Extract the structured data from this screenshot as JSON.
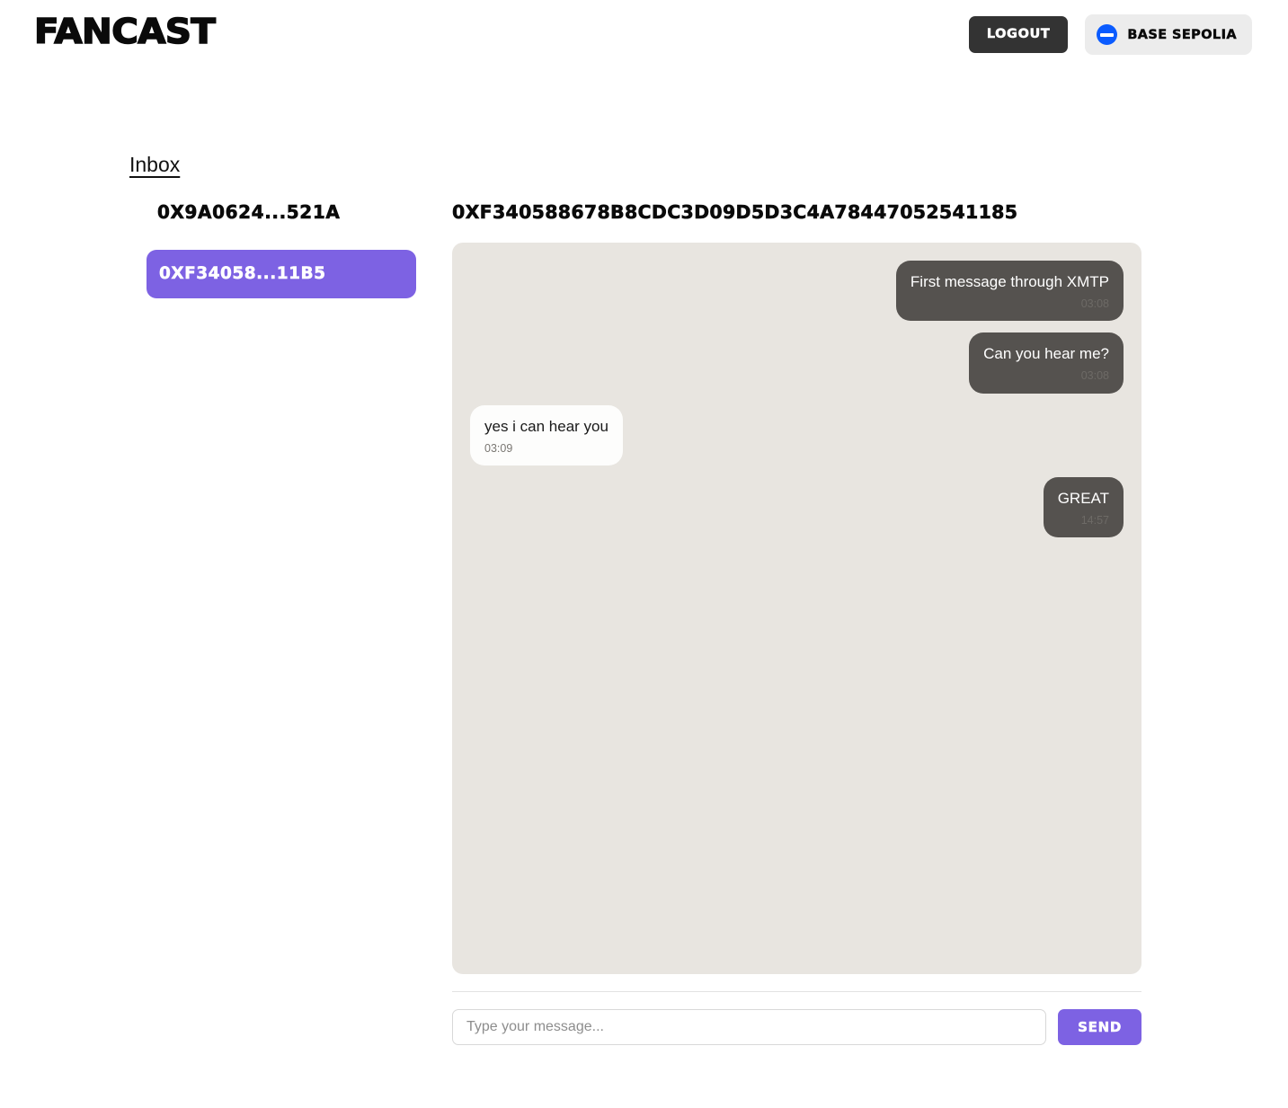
{
  "header": {
    "brand": "FANCAST",
    "logout_label": "LOGOUT",
    "network_label": "BASE SEPOLIA",
    "network_icon": "base-logo-icon",
    "accent_purple": "#7d62e3",
    "logout_bg": "#333333",
    "network_chip_bg": "#ececec",
    "network_dot_color": "#0a5bff"
  },
  "nav": {
    "inbox_label": "Inbox"
  },
  "sidebar": {
    "wallet_address": "0X9A0624...521A",
    "conversations": [
      {
        "label": "0XF34058...11B5",
        "selected": true
      }
    ]
  },
  "chat": {
    "peer_address": "0XF340588678B8CDC3D09D5D3C4A78447052541185",
    "panel_bg": "#e8e5e0",
    "messages": [
      {
        "text": "First message through XMTP",
        "time": "03:08",
        "direction": "out"
      },
      {
        "text": "Can you hear me?",
        "time": "03:08",
        "direction": "out"
      },
      {
        "text": "yes i can hear you",
        "time": "03:09",
        "direction": "in"
      },
      {
        "text": "GREAT",
        "time": "14:57",
        "direction": "out"
      }
    ]
  },
  "composer": {
    "placeholder": "Type your message...",
    "value": "",
    "send_label": "SEND"
  }
}
